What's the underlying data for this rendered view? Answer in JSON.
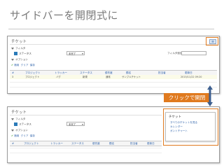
{
  "slide": {
    "title": "サイドバーを開閉式に",
    "callout": "クリックで開閉"
  },
  "screen": {
    "heading": "チケット",
    "filter_label": "フィルタ",
    "status_label": "ステータス",
    "status_value": "未完了",
    "add_filter_label": "フィルタ追加",
    "options_label": "オプション",
    "actions": [
      "適用",
      "クリア",
      "保存"
    ],
    "columns": [
      "#",
      "プロジェクト",
      "トラッカー",
      "ステータス",
      "優先度",
      "題名",
      "担当者",
      "更新日"
    ],
    "rows": [
      [
        "3",
        "プロジェクト",
        "バグ",
        "新規",
        "通常",
        "サンプルチケット",
        "",
        "2015/11/22 09:20"
      ]
    ],
    "menu_button": "≡"
  },
  "sidebar": {
    "heading": "チケット",
    "items": [
      "すべてのチケットを見る",
      "カレンダー",
      "ガントチャート"
    ]
  },
  "colors": {
    "accent": "#e07a1f",
    "link": "#2a5fa8",
    "arrow": "#3d5f8f"
  }
}
